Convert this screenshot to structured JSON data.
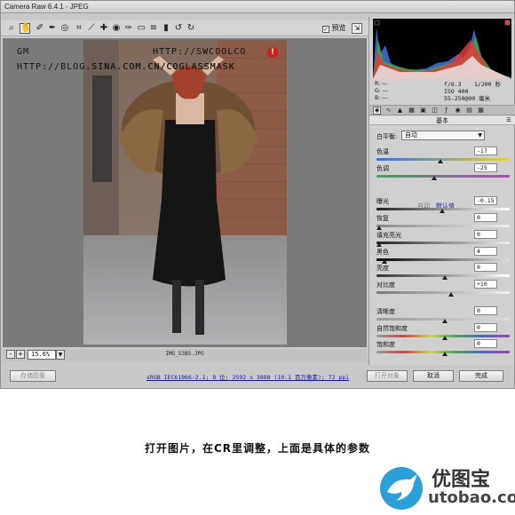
{
  "window": {
    "title": "Camera Raw 6.4.1 - JPEG"
  },
  "toolbar": {
    "tools": [
      {
        "icon": "zoom-icon",
        "glyph": "🔍"
      },
      {
        "icon": "hand-icon",
        "glyph": "✋"
      },
      {
        "icon": "white-balance-icon",
        "glyph": "✎"
      },
      {
        "icon": "color-sampler-icon",
        "glyph": "✒"
      },
      {
        "icon": "target-adjust-icon",
        "glyph": "◎"
      },
      {
        "icon": "crop-icon",
        "glyph": "⌗"
      },
      {
        "icon": "straighten-icon",
        "glyph": "⟋"
      },
      {
        "icon": "spot-removal-icon",
        "glyph": "✚"
      },
      {
        "icon": "red-eye-icon",
        "glyph": "◉"
      },
      {
        "icon": "adjustment-brush-icon",
        "glyph": "✐"
      },
      {
        "icon": "graduated-filter-icon",
        "glyph": "▭"
      },
      {
        "icon": "preferences-icon",
        "glyph": "≡"
      },
      {
        "icon": "trash-icon",
        "glyph": "▮"
      },
      {
        "icon": "rotate-left-icon",
        "glyph": "↺"
      },
      {
        "icon": "rotate-right-icon",
        "glyph": "↻"
      }
    ],
    "preview_label": "预览",
    "preview_checked": true
  },
  "photo": {
    "watermark_left": "GM",
    "watermark_right": "HTTP://SWCOOLCO",
    "watermark_url": "HTTP://BLOG.SINA.COM.CN/COGLASSMASK"
  },
  "status": {
    "zoom": "15.6%",
    "filename": "IMG_5385.JPG"
  },
  "bottom": {
    "save_label": "存储图像",
    "info_link": "sRGB IEC61966-2.1; 8 位; 2592 x 3888 (10.1 百万像素); 72 ppi",
    "open_label": "打开对象",
    "cancel_label": "取消",
    "done_label": "完成"
  },
  "readout": {
    "r": "R:  ---",
    "g": "G:  ---",
    "b": "B:  ---",
    "aperture": "f/6.3",
    "shutter": "1/200 秒",
    "iso": "ISO 400",
    "lens": "55-250@90 毫米"
  },
  "panel": {
    "section_title": "基本",
    "wb_label": "白平衡:",
    "wb_value": "自动",
    "auto_label": "自动",
    "default_label": "默认值",
    "controls": [
      {
        "key": "temperature",
        "label": "色温",
        "value": "-17",
        "level": 0.47
      },
      {
        "key": "tint",
        "label": "色调",
        "value": "-25",
        "level": 0.42
      },
      {
        "key": "exposure",
        "label": "曝光",
        "value": "-0.15",
        "level": 0.48
      },
      {
        "key": "recovery",
        "label": "恢复",
        "value": "0",
        "level": 0.0
      },
      {
        "key": "fill-light",
        "label": "填充亮光",
        "value": "0",
        "level": 0.0
      },
      {
        "key": "blacks",
        "label": "黑色",
        "value": "4",
        "level": 0.04
      },
      {
        "key": "brightness",
        "label": "亮度",
        "value": "0",
        "level": 0.5
      },
      {
        "key": "contrast",
        "label": "对比度",
        "value": "+10",
        "level": 0.55
      },
      {
        "key": "clarity",
        "label": "清晰度",
        "value": "0",
        "level": 0.5
      },
      {
        "key": "vibrance",
        "label": "自然饱和度",
        "value": "0",
        "level": 0.5
      },
      {
        "key": "saturation",
        "label": "饱和度",
        "value": "0",
        "level": 0.5
      }
    ]
  },
  "caption": "打开图片，在CR里调整，上面是具体的参数",
  "logo": {
    "title": "优图宝",
    "url": "utobao.com",
    "brand_color": "#2a9fd8"
  }
}
